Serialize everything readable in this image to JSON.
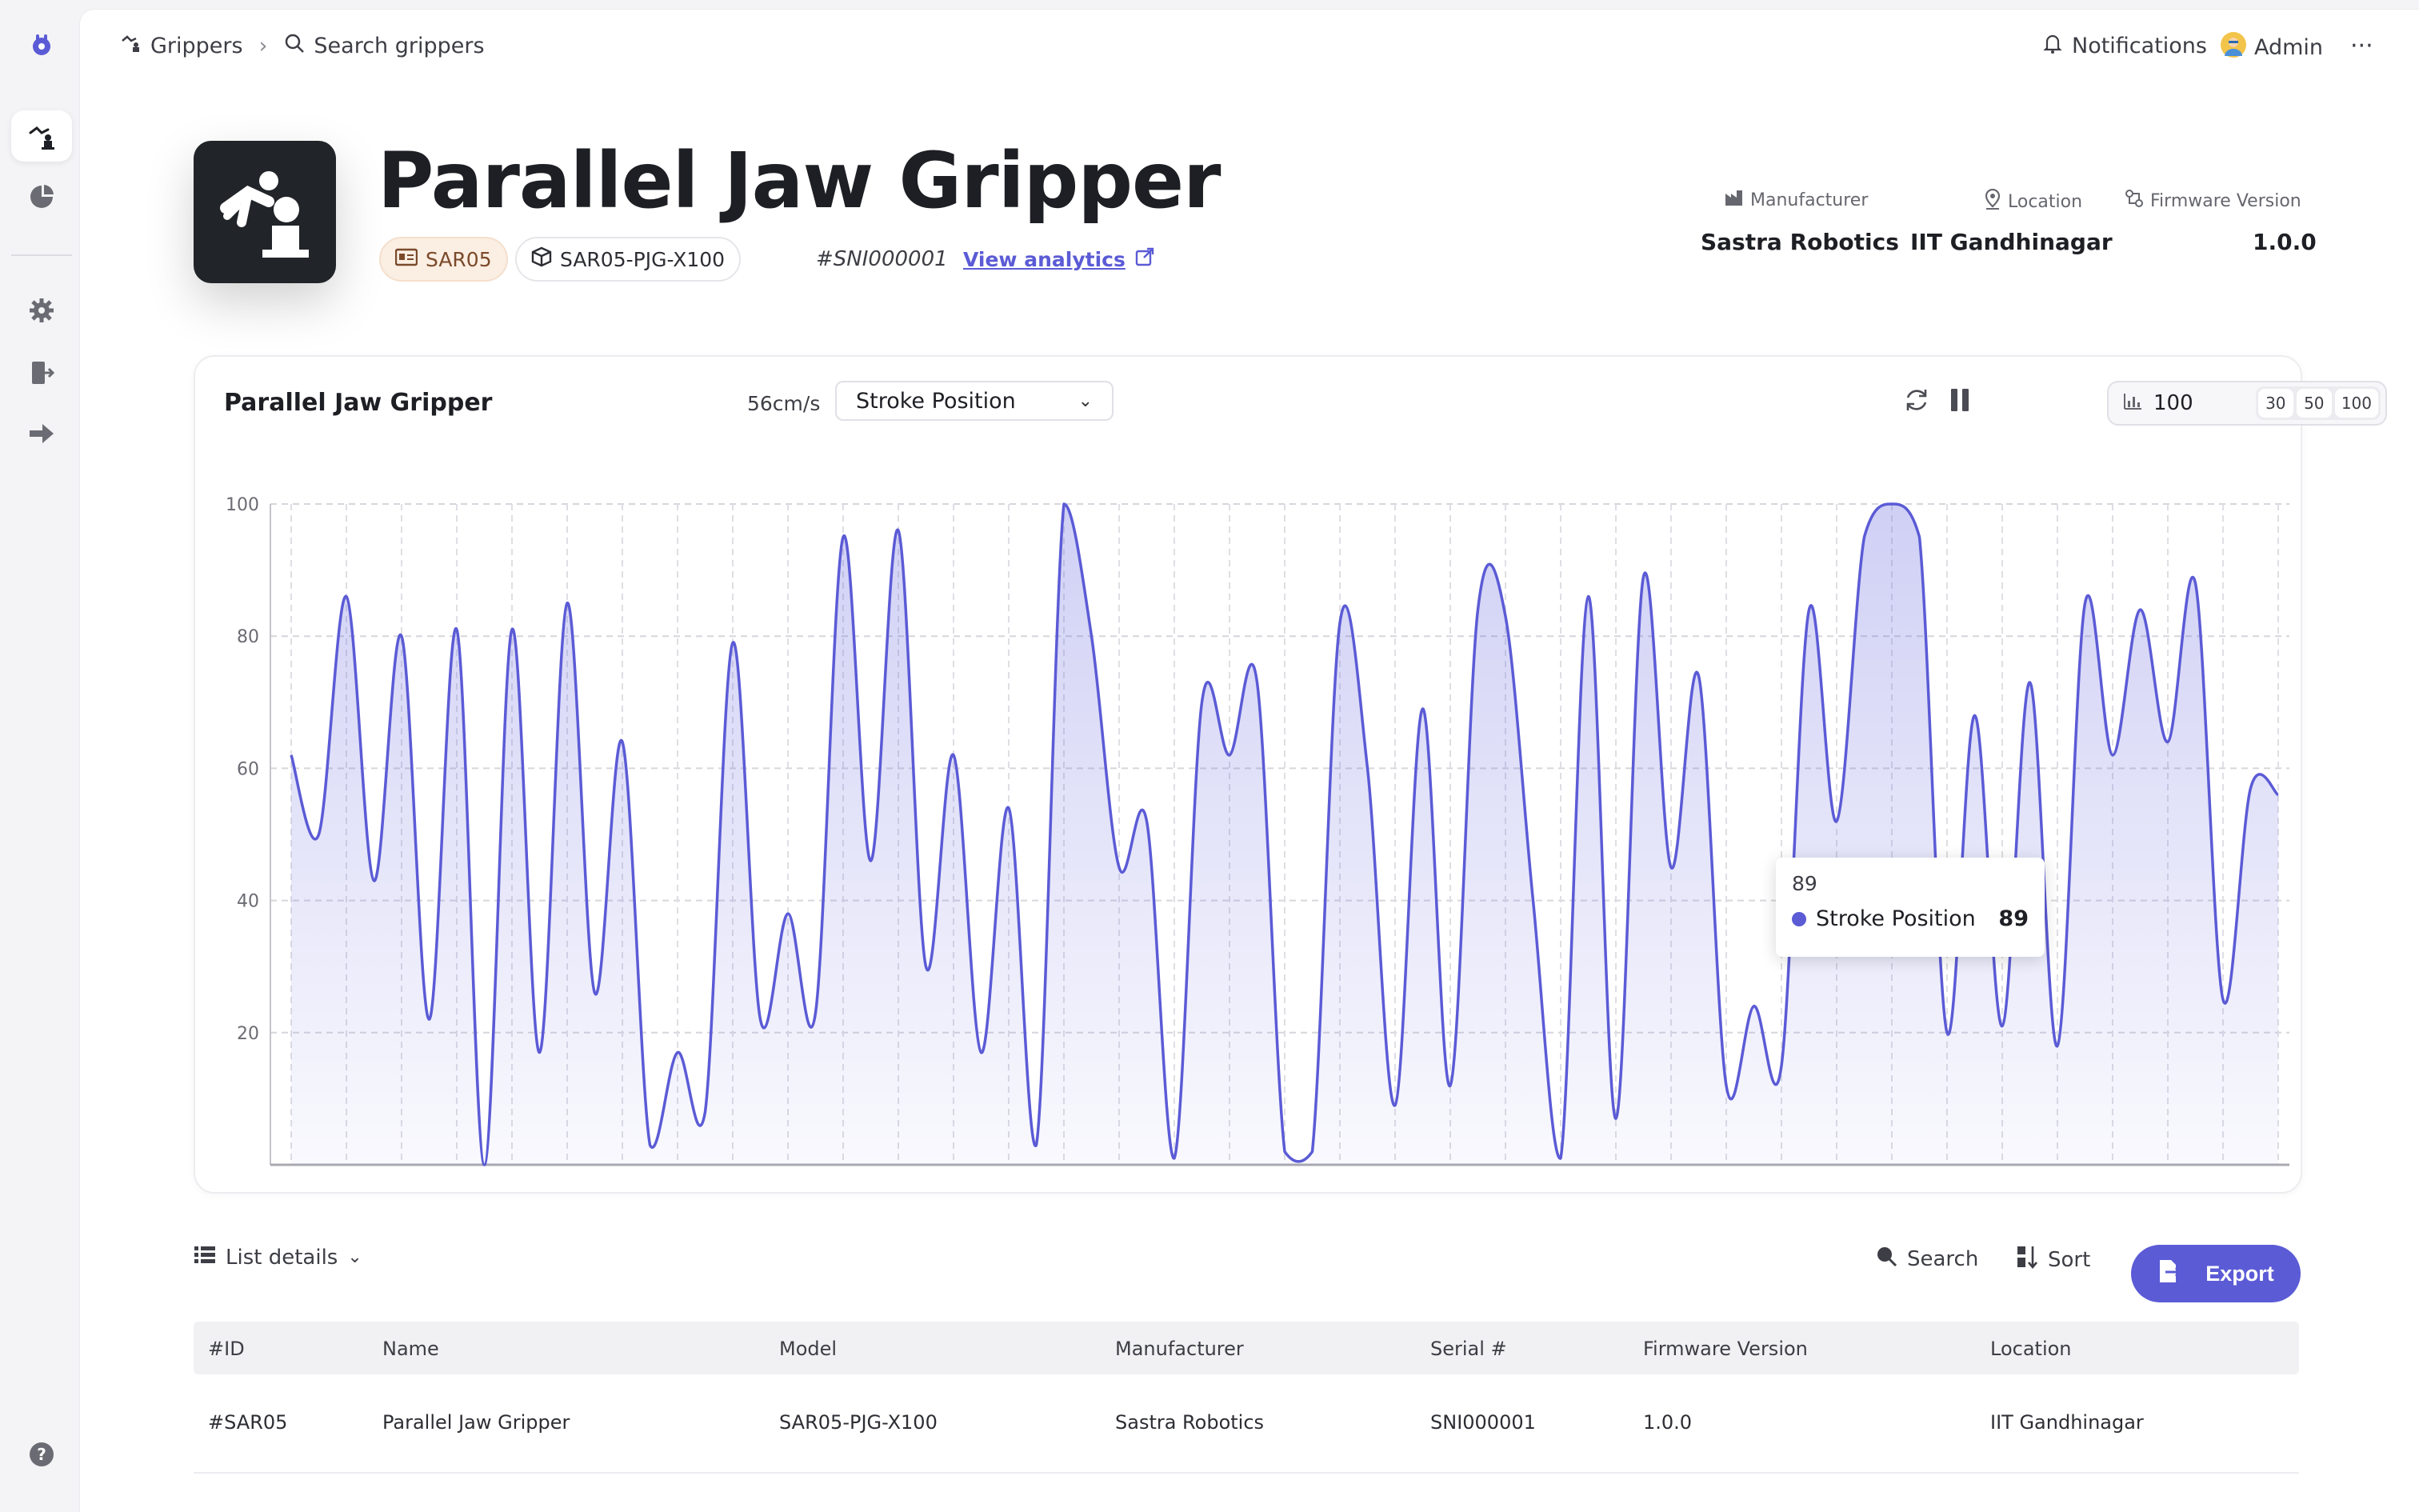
{
  "nav": {
    "sidebar_icons": [
      "logo-icon",
      "robot-arm-icon",
      "pie-chart-icon",
      "gear-icon",
      "logout-door-icon",
      "arrow-right-icon",
      "help-icon"
    ]
  },
  "breadcrumb": {
    "section": "Grippers",
    "search_label": "Search grippers"
  },
  "header_actions": {
    "notifications": "Notifications",
    "user": "Admin",
    "more": "···"
  },
  "device": {
    "title": "Parallel Jaw Gripper",
    "code": "SAR05",
    "model": "SAR05-PJG-X100",
    "serial": "#SNI000001",
    "analytics_link": "View analytics"
  },
  "meta": {
    "manufacturer_label": "Manufacturer",
    "manufacturer": "Sastra Robotics",
    "location_label": "Location",
    "location": "IIT Gandhinagar",
    "firmware_label": "Firmware Version",
    "firmware": "1.0.0"
  },
  "chart_panel": {
    "title": "Parallel Jaw Gripper",
    "speed": "56cm/s",
    "metric": "Stroke Position",
    "range_value": "100",
    "range_options": [
      "30",
      "50",
      "100"
    ]
  },
  "tooltip": {
    "title": "89",
    "series": "Stroke Position",
    "value": "89"
  },
  "chart_data": {
    "type": "area",
    "xlabel": "",
    "ylabel": "",
    "ylim": [
      0,
      100
    ],
    "yticks": [
      20,
      40,
      60,
      80,
      100
    ],
    "grid": true,
    "series": [
      {
        "name": "Stroke Position",
        "color": "#5b5bd6",
        "values": [
          62,
          50,
          86,
          43,
          80,
          22,
          81,
          0,
          81,
          17,
          85,
          26,
          64,
          3,
          17,
          8,
          79,
          22,
          38,
          23,
          95,
          46,
          96,
          30,
          62,
          17,
          54,
          3,
          100,
          80,
          45,
          52,
          1,
          70,
          62,
          73,
          2,
          2,
          82,
          60,
          9,
          69,
          12,
          84,
          83,
          40,
          1,
          86,
          7,
          89,
          45,
          74,
          12,
          24,
          15,
          84,
          52,
          95,
          100,
          95,
          20,
          68,
          21,
          73,
          18,
          85,
          62,
          84,
          64,
          88,
          25,
          57,
          56
        ]
      }
    ]
  },
  "list": {
    "view_label": "List details",
    "search_label": "Search",
    "sort_label": "Sort",
    "export_label": "Export",
    "columns": [
      "#ID",
      "Name",
      "Model",
      "Manufacturer",
      "Serial #",
      "Firmware Version",
      "Location"
    ],
    "rows": [
      [
        "#SAR05",
        "Parallel Jaw Gripper",
        "SAR05-PJG-X100",
        "Sastra Robotics",
        "SNI000001",
        "1.0.0",
        "IIT Gandhinagar"
      ]
    ]
  }
}
